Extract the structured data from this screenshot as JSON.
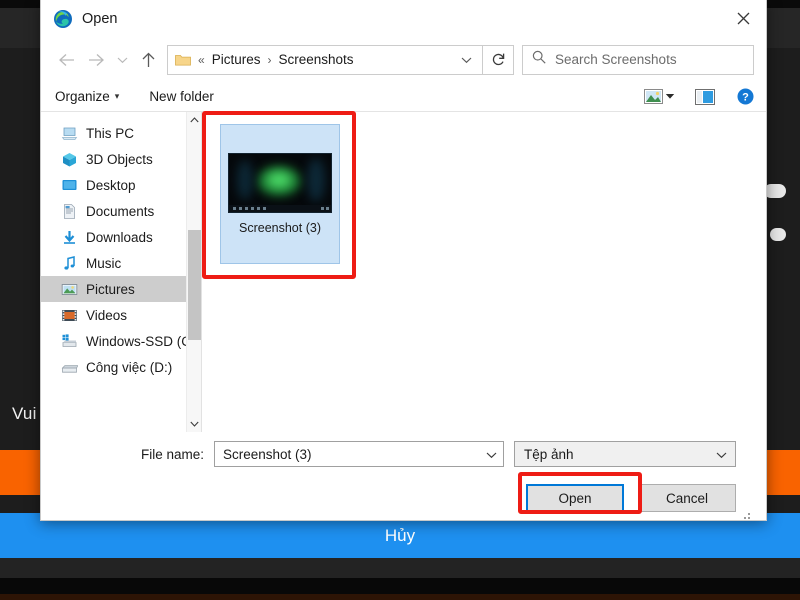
{
  "background": {
    "text_fragment": "Vui",
    "cancel_bar_label": "Hủy",
    "accent_orange": "#f96300",
    "accent_blue": "#1e90f0"
  },
  "dialog": {
    "title": "Open",
    "title_icon": "edge-logo-icon",
    "close_icon": "close-icon",
    "nav": {
      "back_icon": "arrow-left-icon",
      "forward_icon": "arrow-right-icon",
      "recent_icon": "chevron-down-icon",
      "up_icon": "arrow-up-icon",
      "refresh_icon": "refresh-icon",
      "address": {
        "folder_icon": "folder-icon",
        "root_sep": "«",
        "crumbs": [
          "Pictures",
          "Screenshots"
        ],
        "separator": "›",
        "dropdown_icon": "chevron-down-icon"
      },
      "search": {
        "icon": "search-icon",
        "placeholder": "Search Screenshots",
        "value": ""
      }
    },
    "toolbar": {
      "organize_label": "Organize",
      "organize_caret": "▾",
      "new_folder_label": "New folder",
      "view_icon": "view-layout-icon",
      "view_caret_icon": "chevron-down-icon",
      "preview_pane_icon": "preview-pane-icon",
      "help_icon": "help-icon"
    },
    "sidebar": {
      "items": [
        {
          "label": "This PC",
          "icon": "this-pc-icon",
          "selected": false
        },
        {
          "label": "3D Objects",
          "icon": "3d-objects-icon",
          "selected": false
        },
        {
          "label": "Desktop",
          "icon": "desktop-icon",
          "selected": false
        },
        {
          "label": "Documents",
          "icon": "documents-icon",
          "selected": false
        },
        {
          "label": "Downloads",
          "icon": "downloads-icon",
          "selected": false
        },
        {
          "label": "Music",
          "icon": "music-icon",
          "selected": false
        },
        {
          "label": "Pictures",
          "icon": "pictures-icon",
          "selected": true
        },
        {
          "label": "Videos",
          "icon": "videos-icon",
          "selected": false
        },
        {
          "label": "Windows-SSD (C:)",
          "icon": "drive-windows-icon",
          "selected": false
        },
        {
          "label": "Công việc (D:)",
          "icon": "drive-icon",
          "selected": false
        }
      ],
      "scrollbar": {
        "up_icon": "chevron-up-icon",
        "down_icon": "chevron-down-icon"
      }
    },
    "files": [
      {
        "name": "Screenshot (3)",
        "selected": true,
        "thumbnail": "dark-razer-wallpaper-thumbnail"
      }
    ],
    "footer": {
      "file_name_label": "File name:",
      "file_name_value": "Screenshot (3)",
      "file_name_caret_icon": "chevron-down-icon",
      "file_type_value": "Tệp ảnh",
      "file_type_caret_icon": "chevron-down-icon",
      "open_button": "Open",
      "cancel_button": "Cancel"
    },
    "annotations": {
      "color": "#ee1c15",
      "targets": [
        "file-tile",
        "open-button"
      ]
    }
  }
}
